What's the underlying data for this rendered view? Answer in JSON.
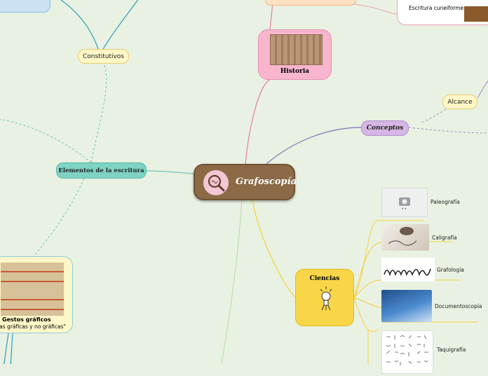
{
  "central": {
    "title": "Grafoscopía"
  },
  "branches": {
    "historia": "Historia",
    "conceptos": "Conceptos",
    "alcance": "Alcance",
    "elementos": "Elementos de la escritura",
    "constitutivos": "Constitutivos",
    "ciencias": "Ciencias",
    "escritura_cuneiforme": "Escritura cuneiforme",
    "gestos_title": "Gestos gráficos",
    "gestos_sub": "cas gráficas y no gráficas\""
  },
  "ciencias_items": [
    {
      "label": "Paleografía",
      "image": "camera-placeholder"
    },
    {
      "label": "Caligrafía",
      "image": "hand-writing-photo"
    },
    {
      "label": "Grafología",
      "image": "mentira-word"
    },
    {
      "label": "Documentoscopía",
      "image": "document-exam-photo"
    },
    {
      "label": "Taquigrafía",
      "image": "shorthand-chart"
    }
  ],
  "colors": {
    "background": "#e9f1e2",
    "central": "#8c6a45",
    "historia": "#f7b5ce",
    "conceptos": "#d6b6e4",
    "elementos": "#7ed3c4",
    "ciencias": "#f9d648",
    "sub_topic": "#fff7c8"
  }
}
